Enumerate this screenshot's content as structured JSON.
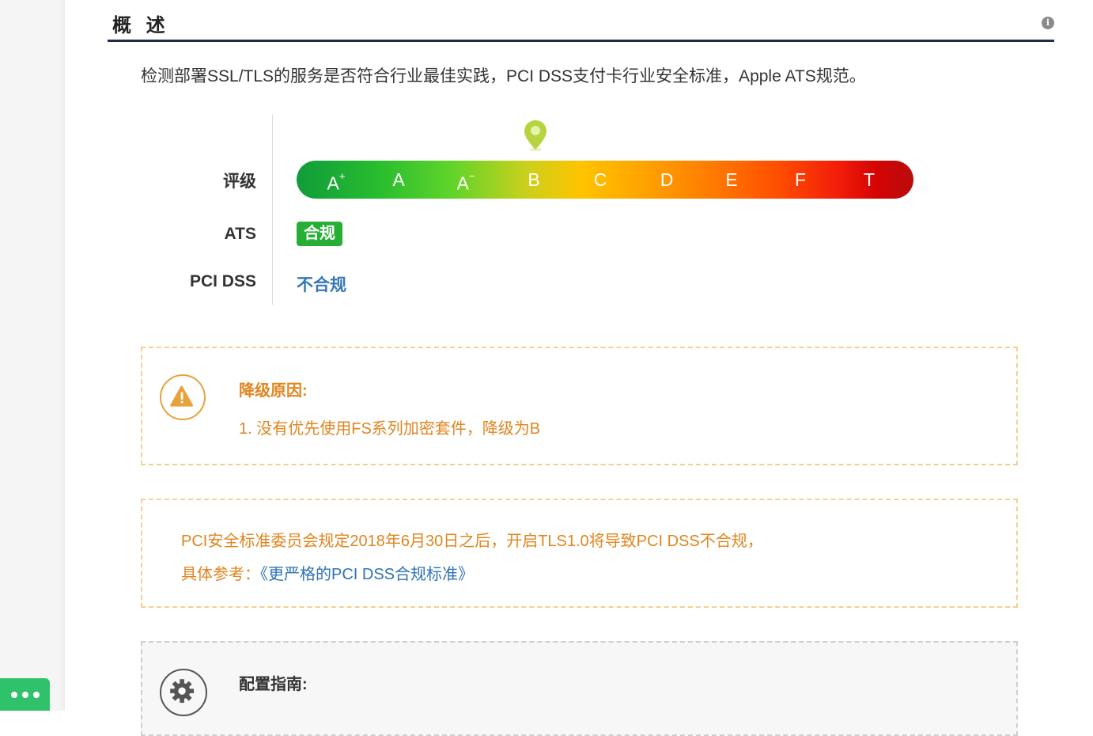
{
  "section": {
    "title": "概 述",
    "info_icon": "info-icon",
    "description": "检测部署SSL/TLS的服务是否符合行业最佳实践，PCI DSS支付卡行业安全标准，Apple ATS规范。"
  },
  "rating": {
    "grade_label": "评级",
    "grades": [
      {
        "letter": "A",
        "mod": "+"
      },
      {
        "letter": "A",
        "mod": ""
      },
      {
        "letter": "A",
        "mod": "−"
      },
      {
        "letter": "B",
        "mod": ""
      },
      {
        "letter": "C",
        "mod": ""
      },
      {
        "letter": "D",
        "mod": ""
      },
      {
        "letter": "E",
        "mod": ""
      },
      {
        "letter": "F",
        "mod": ""
      },
      {
        "letter": "T",
        "mod": ""
      }
    ],
    "current_grade": "B",
    "ats_label": "ATS",
    "ats_value": "合规",
    "pci_label": "PCI DSS",
    "pci_value": "不合规"
  },
  "downgrade": {
    "title": "降级原因:",
    "items": [
      "1. 没有优先使用FS系列加密套件，降级为B"
    ],
    "icon": "warning-icon"
  },
  "pci_notice": {
    "line1": "PCI安全标准委员会规定2018年6月30日之后，开启TLS1.0将导致PCI DSS不合规，",
    "ref_label": "具体参考：",
    "ref_link": "《更严格的PCI DSS合规标准》"
  },
  "config": {
    "title": "配置指南:",
    "icon": "gear-icon"
  },
  "colors": {
    "header_rule": "#1f2d4e",
    "ats_badge": "#27ae36",
    "pci_status": "#3677b8",
    "warning": "#e0851f",
    "chat_fab": "#2fc26b"
  }
}
